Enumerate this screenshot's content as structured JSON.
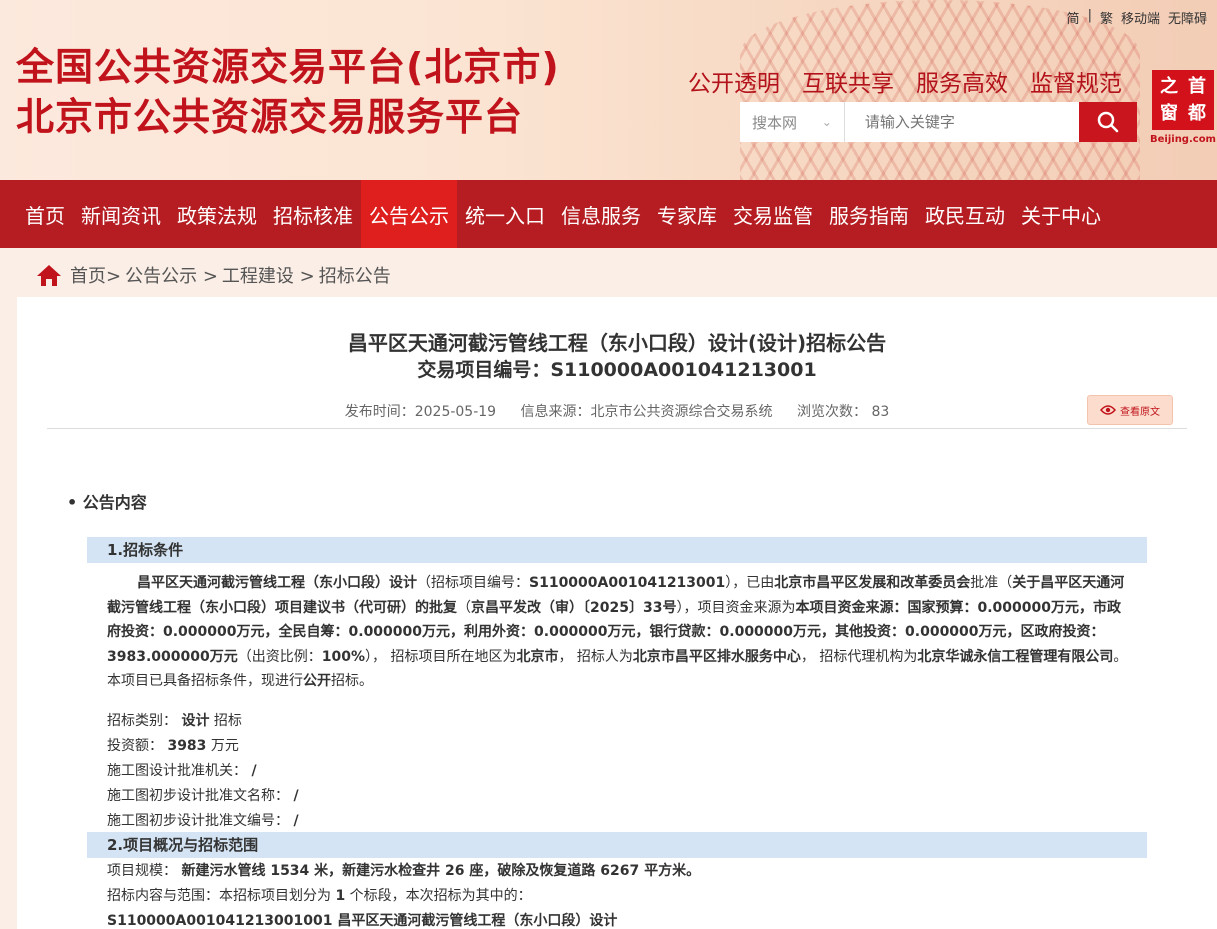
{
  "top_links": [
    "简",
    "繁",
    "移动端",
    "无障碍"
  ],
  "site_title_1": "全国公共资源交易平台(北京市)",
  "site_title_2": "北京市公共资源交易服务平台",
  "slogans": [
    "公开透明",
    "互联共享",
    "服务高效",
    "监督规范"
  ],
  "seal_text": [
    "首",
    "都",
    "之",
    "窗"
  ],
  "seal_caption": "Beijing.com",
  "search": {
    "scope": "搜本网",
    "placeholder": "请输入关键字"
  },
  "nav": [
    "首页",
    "新闻资讯",
    "政策法规",
    "招标核准",
    "公告公示",
    "统一入口",
    "信息服务",
    "专家库",
    "交易监管",
    "服务指南",
    "政民互动",
    "关于中心"
  ],
  "nav_active_index": 4,
  "breadcrumb": [
    "首页>",
    "公告公示 >",
    "工程建设 >",
    "招标公告"
  ],
  "article": {
    "title": "昌平区天通河截污管线工程（东小口段）设计(设计)招标公告",
    "code_label": "交易项目编号：",
    "code": "S110000A001041213001",
    "publish_time": "发布时间：2025-05-19",
    "source": "信息来源：北京市公共资源综合交易系统",
    "views": "浏览次数：  83",
    "view_original": "查看原文",
    "section": "• 公告内容",
    "bar1": "1.招标条件",
    "p1": {
      "t1": "昌平区天通河截污管线工程（东小口段）设计",
      "t2": "（招标项目编号：",
      "t3": "S110000A001041213001",
      "t4": "），已由",
      "t5": "北京市昌平区发展和改革委员会",
      "t6": "批准（",
      "t7": "关于昌平区天通河截污管线工程（东小口段）项目建议书（代可研）的批复",
      "t8": "（",
      "t9": "京昌平发改（审）〔2025〕33号",
      "t10": "），项目资金来源为",
      "t11": "本项目资金来源：国家预算：0.000000万元，市政府投资：0.000000万元，全民自筹：0.000000万元，利用外资：0.000000万元，银行贷款：0.000000万元，其他投资：0.000000万元，区政府投资：3983.000000万元",
      "t12": "（出资比例：",
      "t13": "100%",
      "t14": "），  招标项目所在地区为",
      "t15": "北京市",
      "t16": "，  招标人为",
      "t17": "北京市昌平区排水服务中心",
      "t18": "，  招标代理机构为",
      "t19": "北京华诚永信工程管理有限公司",
      "t20": "。本项目已具备招标条件，现进行",
      "t21": "公开",
      "t22": "招标。"
    },
    "lines": [
      {
        "label": "招标类别：",
        "value": "设计",
        "suffix": " 招标"
      },
      {
        "label": "投资额：",
        "value": "3983",
        "suffix": " 万元"
      },
      {
        "label": "施工图设计批准机关：",
        "value": "/",
        "suffix": ""
      },
      {
        "label": "施工图初步设计批准文名称：",
        "value": "/",
        "suffix": ""
      },
      {
        "label": "施工图初步设计批准文编号：",
        "value": "/",
        "suffix": ""
      }
    ],
    "bar2": "2.项目概况与招标范围",
    "scale_label": "项目规模：",
    "scale_value": "新建污水管线 1534 米，新建污水检查井 26 座，破除及恢复道路 6267 平方米。",
    "scope_pre": "招标内容与范围：本招标项目划分为",
    "scope_num": "1",
    "scope_post": "个标段，本次招标为其中的：",
    "lot": "S110000A001041213001001 昌平区天通河截污管线工程（东小口段）设计"
  },
  "colors": {
    "brand_red": "#c1131b",
    "nav_bg": "#b51d22",
    "nav_active": "#de1f1e",
    "section_bar": "#d4e4f4"
  }
}
